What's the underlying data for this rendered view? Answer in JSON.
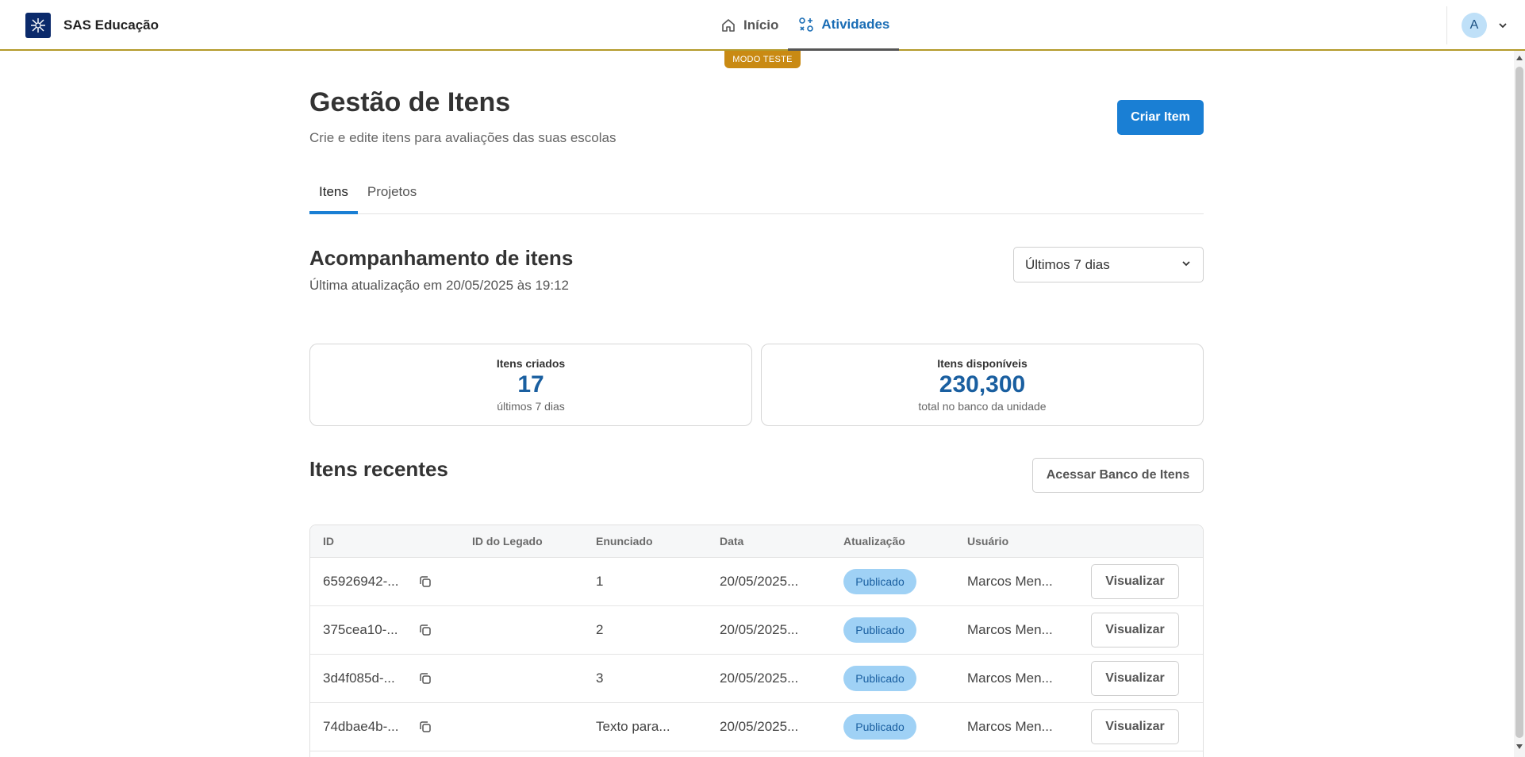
{
  "header": {
    "brand": "SAS Educação",
    "nav": [
      {
        "label": "Início",
        "icon": "home-icon"
      },
      {
        "label": "Atividades",
        "icon": "activities-icon"
      }
    ],
    "avatar_initial": "A",
    "mode_badge": "MODO TESTE"
  },
  "page": {
    "title": "Gestão de Itens",
    "subtitle": "Crie e edite itens para avaliações das suas escolas",
    "create_button": "Criar Item",
    "tabs": [
      "Itens",
      "Projetos"
    ]
  },
  "tracking": {
    "title": "Acompanhamento de itens",
    "updated": "Última atualização em 20/05/2025 às 19:12",
    "period": "Últimos 7 dias"
  },
  "cards": [
    {
      "label": "Itens criados",
      "value": "17",
      "sub": "últimos 7 dias"
    },
    {
      "label": "Itens disponíveis",
      "value": "230,300",
      "sub": "total no banco da unidade"
    }
  ],
  "recent": {
    "title": "Itens recentes",
    "bank_button": "Acessar Banco de Itens",
    "columns": [
      "ID",
      "ID do Legado",
      "Enunciado",
      "Data",
      "Atualização",
      "Usuário"
    ],
    "rows": [
      {
        "id": "65926942-...",
        "legacy": "",
        "statement": "1",
        "date": "20/05/2025...",
        "status": "Publicado",
        "user": "Marcos Men...",
        "action": "Visualizar"
      },
      {
        "id": "375cea10-...",
        "legacy": "",
        "statement": "2",
        "date": "20/05/2025...",
        "status": "Publicado",
        "user": "Marcos Men...",
        "action": "Visualizar"
      },
      {
        "id": "3d4f085d-...",
        "legacy": "",
        "statement": "3",
        "date": "20/05/2025...",
        "status": "Publicado",
        "user": "Marcos Men...",
        "action": "Visualizar"
      },
      {
        "id": "74dbae4b-...",
        "legacy": "",
        "statement": "Texto para...",
        "date": "20/05/2025...",
        "status": "Publicado",
        "user": "Marcos Men...",
        "action": "Visualizar"
      }
    ]
  }
}
